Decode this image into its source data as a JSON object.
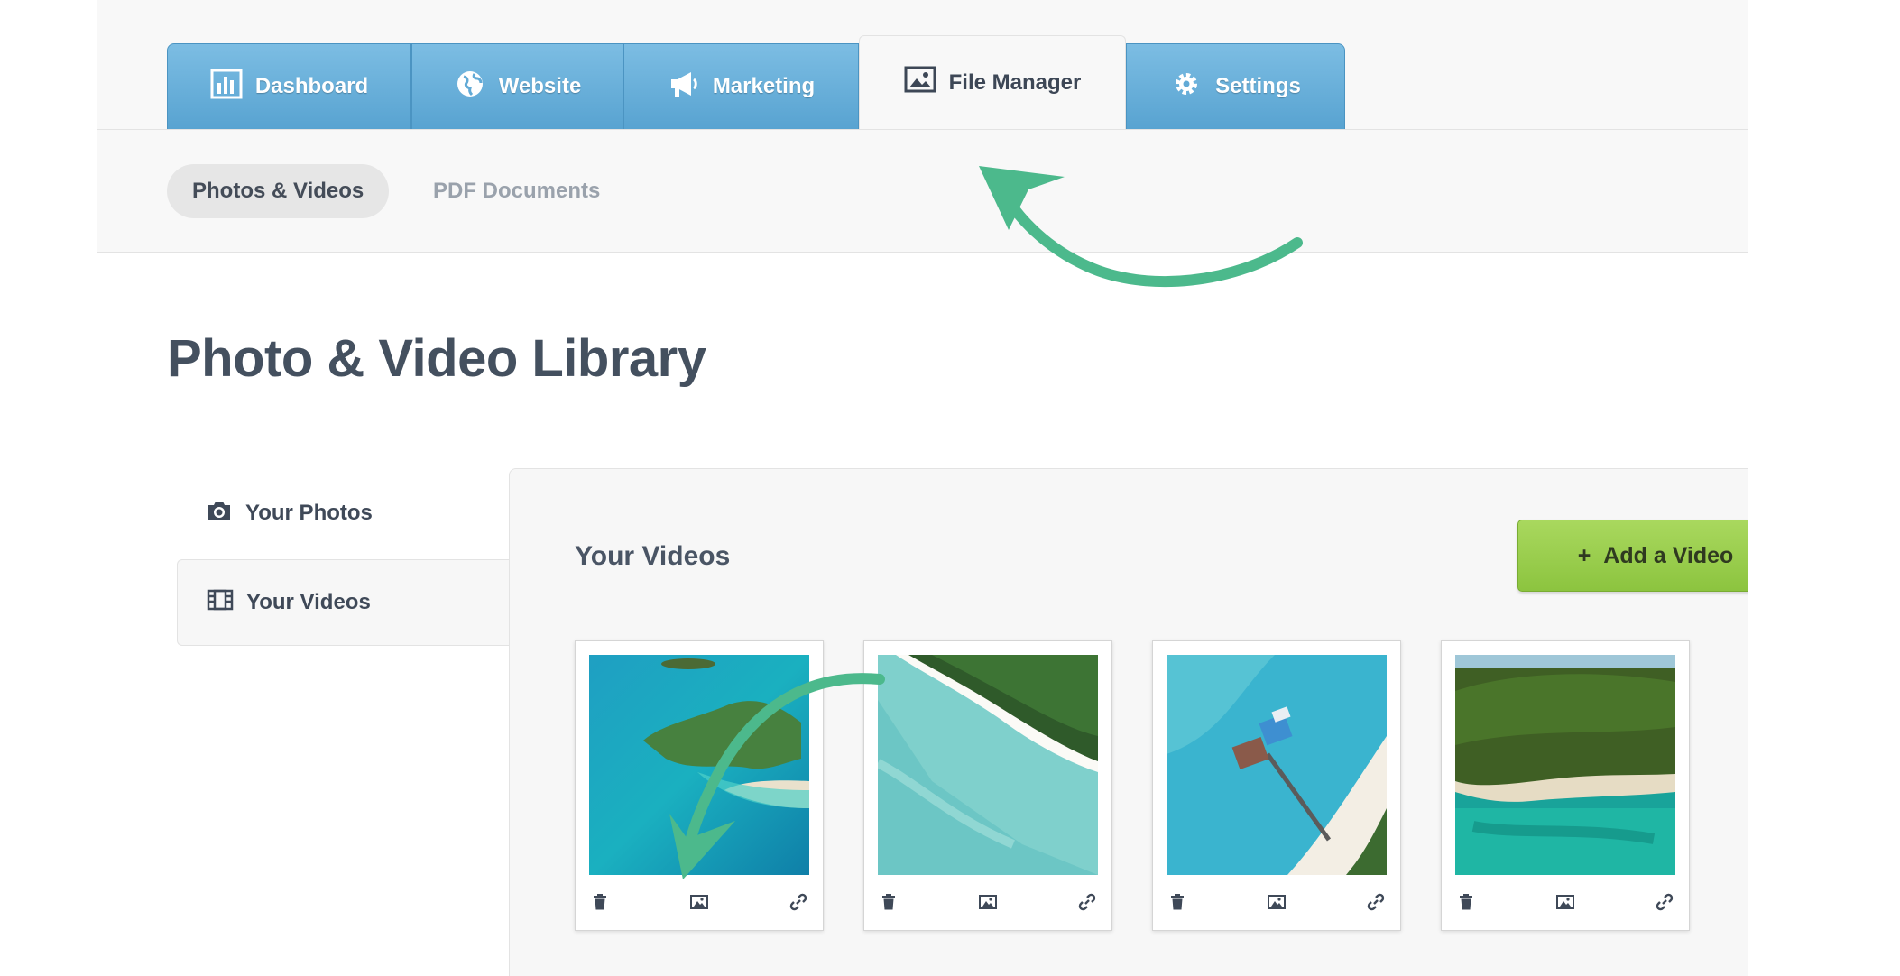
{
  "nav": {
    "tabs": [
      {
        "label": "Dashboard",
        "icon": "bar-chart-icon"
      },
      {
        "label": "Website",
        "icon": "globe-icon"
      },
      {
        "label": "Marketing",
        "icon": "megaphone-icon"
      },
      {
        "label": "File Manager",
        "icon": "image-icon",
        "active": true
      },
      {
        "label": "Settings",
        "icon": "gear-icon"
      }
    ]
  },
  "subnav": {
    "items": [
      {
        "label": "Photos & Videos",
        "active": true
      },
      {
        "label": "PDF Documents"
      }
    ]
  },
  "page": {
    "title": "Photo & Video Library"
  },
  "sidebar": {
    "items": [
      {
        "label": "Your Photos",
        "icon": "camera-icon"
      },
      {
        "label": "Your Videos",
        "icon": "film-icon",
        "active": true
      }
    ]
  },
  "videos": {
    "title": "Your Videos",
    "add_button": {
      "icon": "+",
      "label": "Add a Video"
    },
    "items": [
      {
        "thumbnail": "aerial-island-lagoon"
      },
      {
        "thumbnail": "aerial-beach-coastline"
      },
      {
        "thumbnail": "aerial-pier-beach"
      },
      {
        "thumbnail": "aerial-forest-island"
      }
    ]
  },
  "colors": {
    "tab_blue": "#6cb3dd",
    "add_green": "#9acd4c",
    "annotation_arrow": "#4cb98c",
    "title_text": "#44505f"
  }
}
